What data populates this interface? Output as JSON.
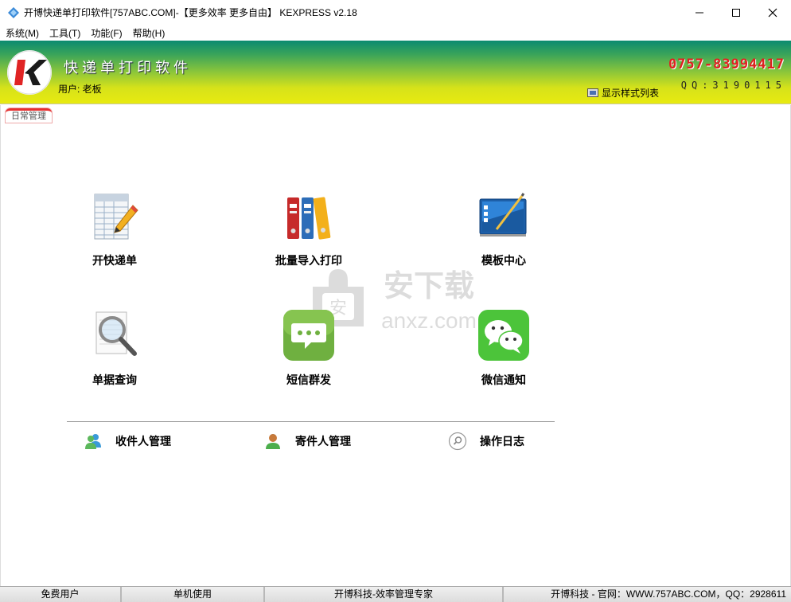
{
  "window": {
    "title": "开博快递单打印软件[757ABC.COM]-【更多效率 更多自由】  KEXPRESS v2.18"
  },
  "menu": [
    "系统(M)",
    "工具(T)",
    "功能(F)",
    "帮助(H)"
  ],
  "header": {
    "app_name": "快递单打印软件",
    "user_label": "用户: 老板",
    "phone": "0757-83994417",
    "qq": "QQ:3190115",
    "style_list_label": "显示样式列表",
    "logo_letter": "K"
  },
  "tabs": [
    "日常管理"
  ],
  "watermark": {
    "text_cn": "安下载",
    "text_en": "anxz.com"
  },
  "tiles": [
    {
      "label": "开快递单",
      "icon": "spreadsheet-pencil-icon"
    },
    {
      "label": "批量导入打印",
      "icon": "binders-icon"
    },
    {
      "label": "模板中心",
      "icon": "template-board-icon"
    },
    {
      "label": "单据查询",
      "icon": "magnifier-document-icon"
    },
    {
      "label": "短信群发",
      "icon": "sms-icon"
    },
    {
      "label": "微信通知",
      "icon": "wechat-icon"
    }
  ],
  "bottom_links": [
    {
      "label": "收件人管理",
      "icon": "users-icon"
    },
    {
      "label": "寄件人管理",
      "icon": "user-icon"
    },
    {
      "label": "操作日志",
      "icon": "search-circle-icon"
    }
  ],
  "status": [
    "免费用户",
    "单机使用",
    "开博科技-效率管理专家",
    "开博科技 - 官网：WWW.757ABC.COM，QQ：2928611"
  ],
  "colors": {
    "header_top": "#0b8a70",
    "header_bottom": "#e8ea10",
    "phone": "#e02020",
    "tab_accent": "#e53030"
  }
}
